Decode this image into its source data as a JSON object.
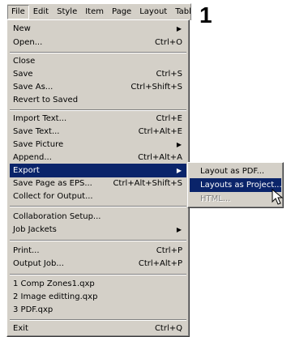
{
  "menubar": {
    "items": [
      {
        "label": "File"
      },
      {
        "label": "Edit"
      },
      {
        "label": "Style"
      },
      {
        "label": "Item"
      },
      {
        "label": "Page"
      },
      {
        "label": "Layout"
      },
      {
        "label": "Tabl"
      }
    ]
  },
  "step_number": "1",
  "file_menu": {
    "items": [
      {
        "label": "New",
        "shortcut": ""
      },
      {
        "label": "Open...",
        "shortcut": "Ctrl+O"
      },
      {
        "label": "Close",
        "shortcut": ""
      },
      {
        "label": "Save",
        "shortcut": "Ctrl+S"
      },
      {
        "label": "Save As...",
        "shortcut": "Ctrl+Shift+S"
      },
      {
        "label": "Revert to Saved",
        "shortcut": ""
      },
      {
        "label": "Import Text...",
        "shortcut": "Ctrl+E"
      },
      {
        "label": "Save Text...",
        "shortcut": "Ctrl+Alt+E"
      },
      {
        "label": "Save Picture",
        "shortcut": ""
      },
      {
        "label": "Append...",
        "shortcut": "Ctrl+Alt+A"
      },
      {
        "label": "Export",
        "shortcut": ""
      },
      {
        "label": "Save Page as EPS...",
        "shortcut": "Ctrl+Alt+Shift+S"
      },
      {
        "label": "Collect for Output...",
        "shortcut": ""
      },
      {
        "label": "Collaboration Setup...",
        "shortcut": ""
      },
      {
        "label": "Job Jackets",
        "shortcut": ""
      },
      {
        "label": "Print...",
        "shortcut": "Ctrl+P"
      },
      {
        "label": "Output Job...",
        "shortcut": "Ctrl+Alt+P"
      },
      {
        "label": "1 Comp Zones1.qxp",
        "shortcut": ""
      },
      {
        "label": "2 Image editting.qxp",
        "shortcut": ""
      },
      {
        "label": "3 PDF.qxp",
        "shortcut": ""
      },
      {
        "label": "Exit",
        "shortcut": "Ctrl+Q"
      }
    ]
  },
  "export_submenu": {
    "items": [
      {
        "label": "Layout as PDF..."
      },
      {
        "label": "Layouts as Project..."
      },
      {
        "label": "HTML..."
      }
    ]
  },
  "colors": {
    "highlight": "#0a246a",
    "menu_bg": "#d4d0c8"
  }
}
